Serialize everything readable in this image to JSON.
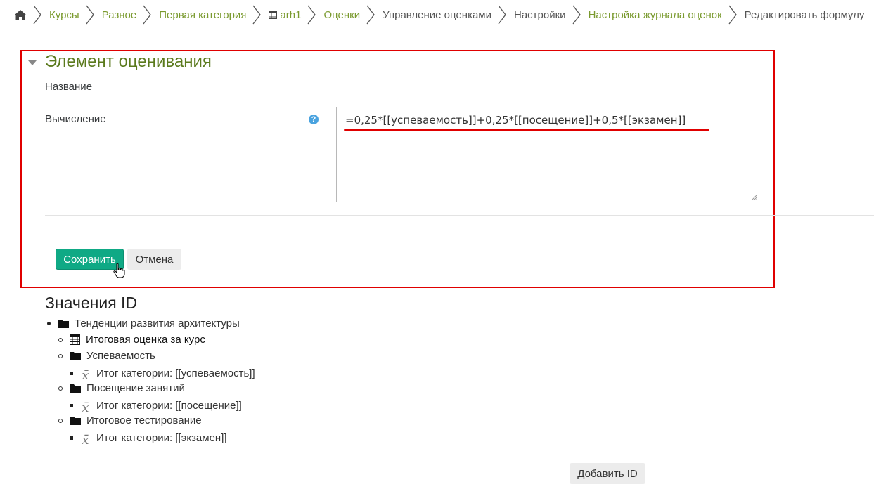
{
  "breadcrumb": {
    "items": [
      {
        "label": "Курсы"
      },
      {
        "label": "Разное"
      },
      {
        "label": "Первая категория"
      },
      {
        "label": "arh1"
      },
      {
        "label": "Оценки"
      },
      {
        "label": "Управление оценками"
      },
      {
        "label": "Настройки"
      },
      {
        "label": "Настройка журнала оценок"
      },
      {
        "label": "Редактировать формулу"
      }
    ]
  },
  "form": {
    "section_title": "Элемент оценивания",
    "name_label": "Название",
    "calc_label": "Вычисление",
    "help_icon": "?",
    "formula": "=0,25*[[успеваемость]]+0,25*[[посещение]]+0,5*[[экзамен]]",
    "save_label": "Сохранить",
    "cancel_label": "Отмена"
  },
  "ids": {
    "title": "Значения ID",
    "course": "Тенденции развития архитектуры",
    "total": "Итоговая оценка за курс",
    "categories": [
      {
        "name": "Успеваемость",
        "item": "Итог категории: [[успеваемость]]"
      },
      {
        "name": "Посещение занятий",
        "item": "Итог категории: [[посещение]]"
      },
      {
        "name": "Итоговое тестирование",
        "item": "Итог категории: [[экзамен]]"
      }
    ],
    "add_label": "Добавить ID"
  },
  "icons": {
    "xbar": "x̄"
  },
  "colors": {
    "link": "#7a9a2e",
    "section_title": "#5b7a1d",
    "primary_button": "#0fa985",
    "highlight": "#e00000"
  }
}
